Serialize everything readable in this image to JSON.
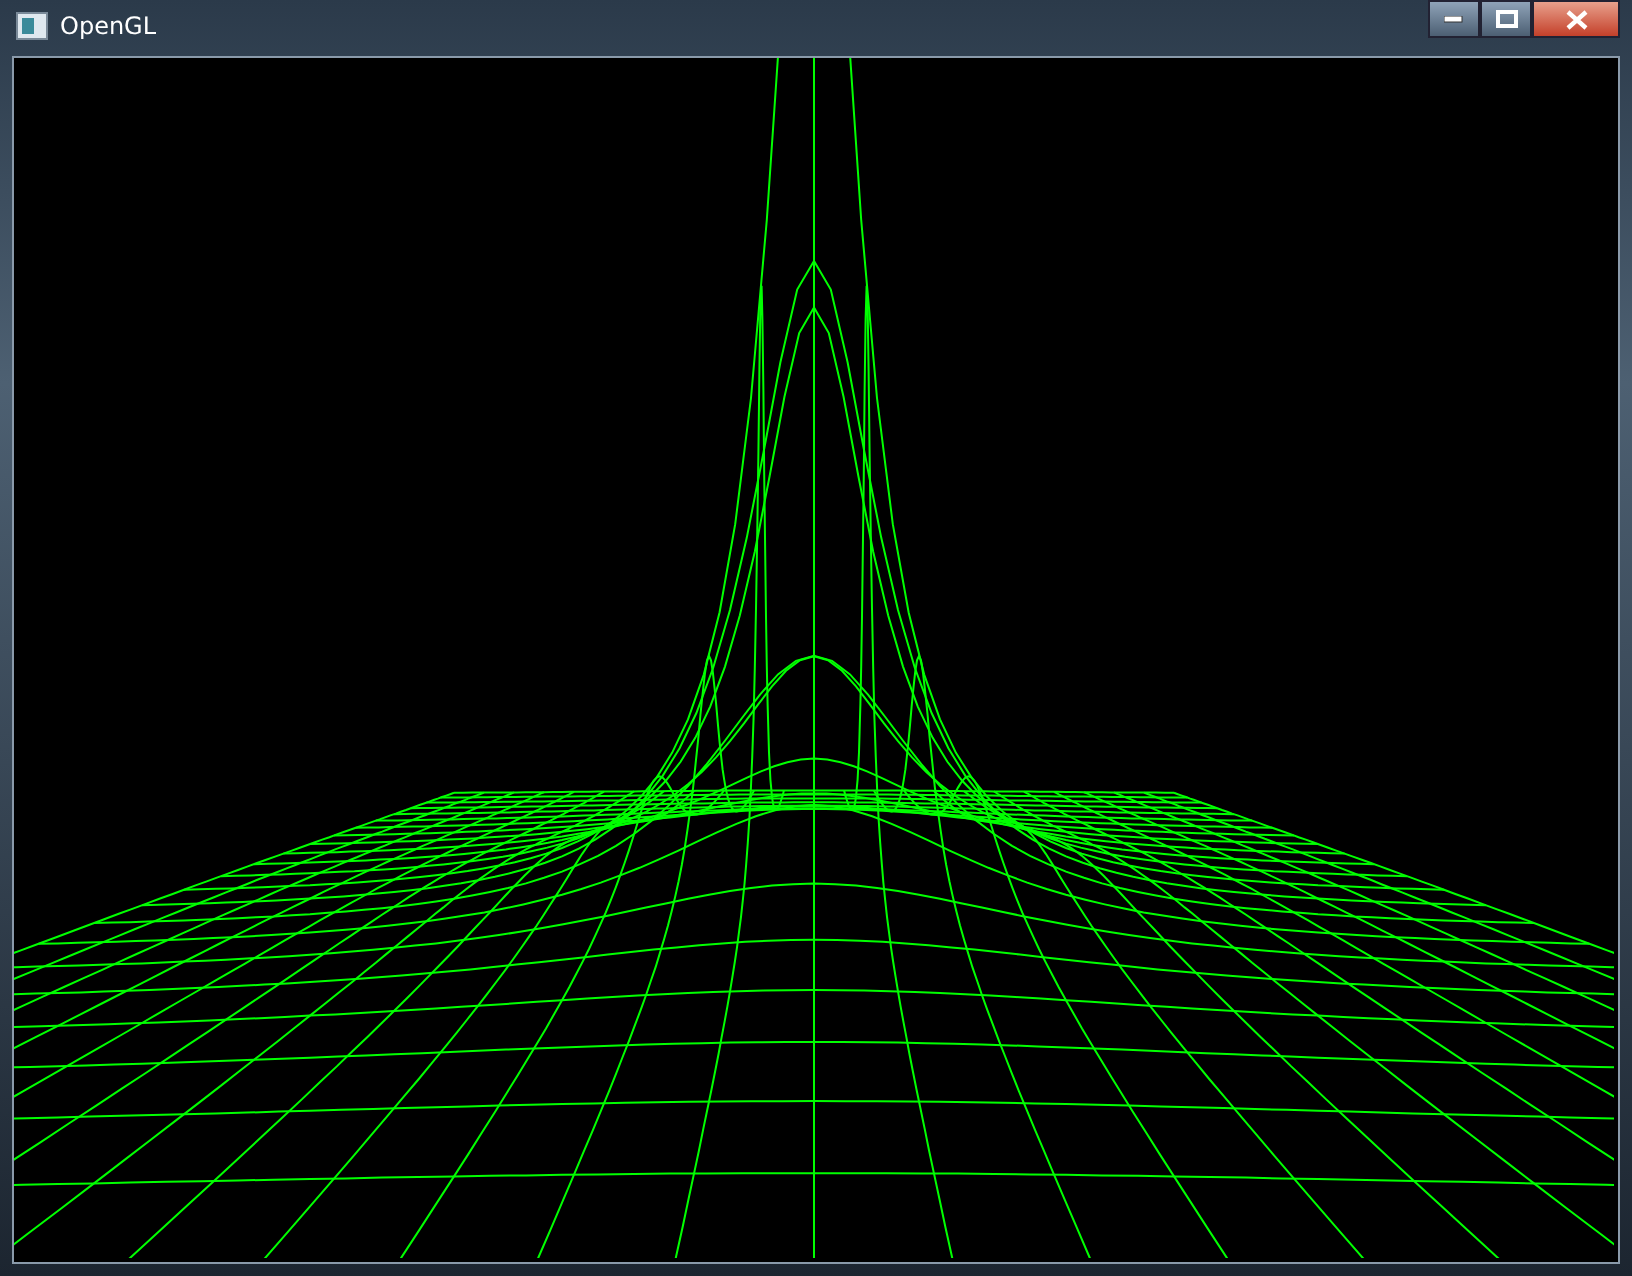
{
  "window": {
    "title": "OpenGL"
  }
}
